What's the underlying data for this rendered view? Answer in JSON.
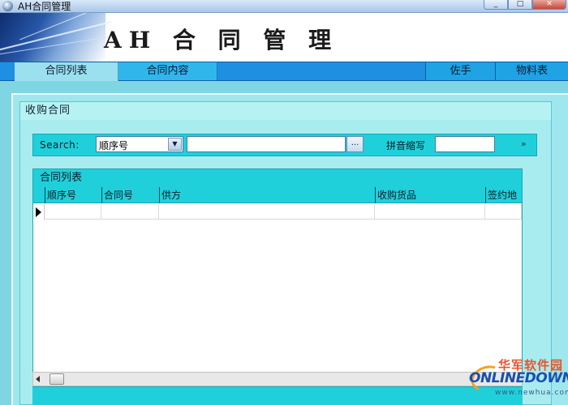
{
  "window": {
    "title": "AH合同管理",
    "minimize": "_",
    "maximize": "□",
    "close": "✕"
  },
  "banner": {
    "app_title": "AH 合 同 管 理"
  },
  "nav": {
    "tabs": [
      {
        "label": "合同列表",
        "active": true
      },
      {
        "label": "合同内容",
        "active": false
      }
    ],
    "right_tabs": [
      {
        "label": "佐手"
      },
      {
        "label": "物料表"
      }
    ]
  },
  "panel": {
    "title": "收购合同"
  },
  "search": {
    "label": "Search:",
    "field_selected": "顺序号",
    "dropdown_arrow": "▼",
    "keyword_value": "",
    "browse_label": "...",
    "pinyin_label": "拼音缩写",
    "pinyin_value": "",
    "more_label": "»"
  },
  "grid": {
    "caption": "合同列表",
    "columns": [
      "顺序号",
      "合同号",
      "供方",
      "收购货品",
      "签约地"
    ],
    "rows": [
      [
        "",
        "",
        "",
        "",
        ""
      ]
    ]
  },
  "watermark": {
    "cn": "华军软件园",
    "en": "ONLINEDOWN",
    "url": "www.newhua.com"
  },
  "colors": {
    "nav_bar": "#1f8fe2",
    "active_tab": "#9be0ee",
    "grid_header": "#1fd0da",
    "panel_bg": "#a9ecef"
  }
}
